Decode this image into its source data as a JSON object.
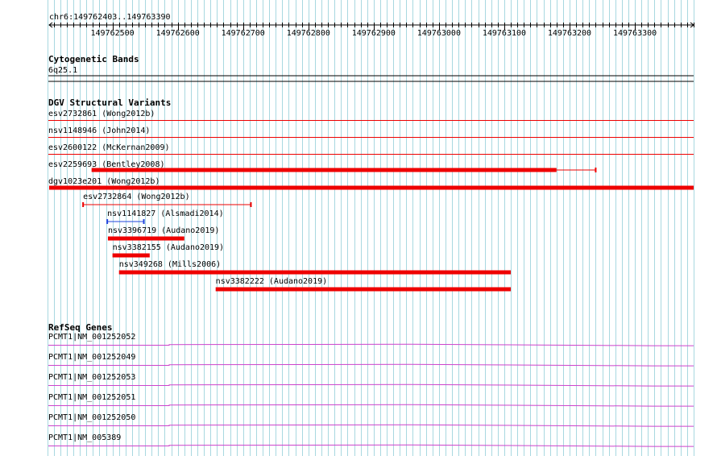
{
  "region": "chr6:149762403..149763390",
  "ruler": {
    "start": 149762403,
    "end": 149763390,
    "ticks": [
      149762500,
      149762600,
      149762700,
      149762800,
      149762900,
      149763000,
      149763100,
      149763200,
      149763300
    ]
  },
  "cytoband": {
    "header": "Cytogenetic Bands",
    "band": "6q25.1"
  },
  "dgv": {
    "header": "DGV Structural Variants",
    "row_labels": [
      "esv2732861 (Wong2012b)",
      "nsv1148946 (John2014)",
      "esv2600122 (McKernan2009)",
      "esv2259693 (Bentley2008)",
      "dgv1023e201 (Wong2012b)"
    ],
    "features": [
      {
        "label": "esv2259693 (Bentley2008)",
        "start": 149762468,
        "end": 149763240,
        "thick_end": 149763180,
        "color": "#ee0000",
        "style": "thick-thin"
      },
      {
        "label": "dgv1023e201 (Wong2012b)",
        "start": 149762403,
        "end": 149763390,
        "color": "#ee0000",
        "style": "thick"
      },
      {
        "label": "esv2732864 (Wong2012b)",
        "start": 149762455,
        "end": 149762712,
        "color": "#ee0000",
        "style": "thin"
      },
      {
        "label": "nsv1141827 (Alsmadi2014)",
        "start": 149762492,
        "end": 149762548,
        "color": "#2244dd",
        "style": "thin"
      },
      {
        "label": "nsv3396719 (Audano2019)",
        "start": 149762493,
        "end": 149762610,
        "color": "#ee0000",
        "style": "thick"
      },
      {
        "label": "nsv3382155 (Audano2019)",
        "start": 149762500,
        "end": 149762557,
        "color": "#ee0000",
        "style": "thick"
      },
      {
        "label": "nsv349268 (Mills2006)",
        "start": 149762510,
        "end": 149763110,
        "color": "#ee0000",
        "style": "thick"
      },
      {
        "label": "nsv3382222 (Audano2019)",
        "start": 149762658,
        "end": 149763110,
        "color": "#ee0000",
        "style": "thick"
      }
    ]
  },
  "refseq": {
    "header": "RefSeq Genes",
    "genes": [
      "PCMT1|NM_001252052",
      "PCMT1|NM_001252049",
      "PCMT1|NM_001252053",
      "PCMT1|NM_001252051",
      "PCMT1|NM_001252050",
      "PCMT1|NM_005389"
    ]
  },
  "colors": {
    "grid": "#a8d8e0",
    "sv": "#ee0000",
    "sv_alt": "#2244dd",
    "gene": "#cc44cc",
    "ruler": "#000000"
  }
}
